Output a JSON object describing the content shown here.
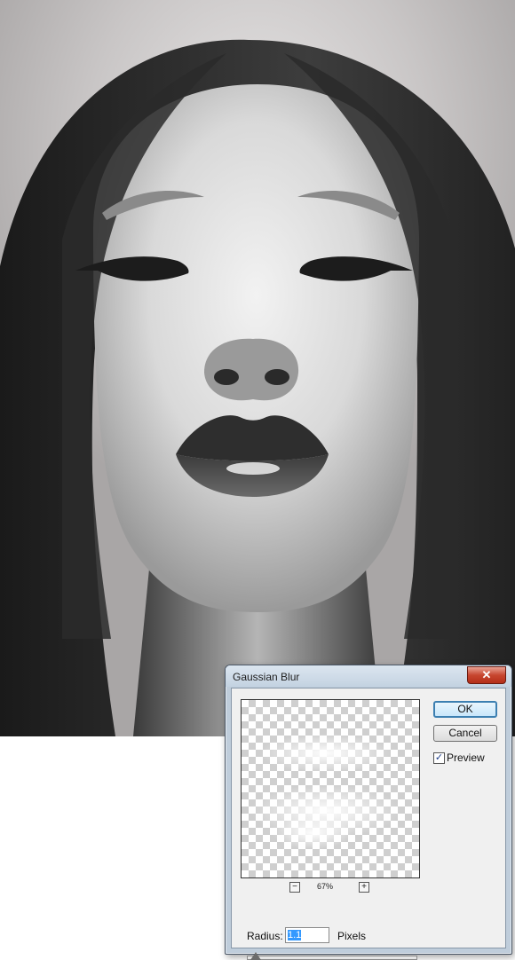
{
  "dialog": {
    "title": "Gaussian Blur",
    "close_symbol": "✕",
    "ok_label": "OK",
    "cancel_label": "Cancel",
    "preview_label": "Preview",
    "preview_checked": true,
    "zoom": {
      "minus": "−",
      "plus": "+",
      "level": "67%"
    },
    "radius": {
      "label": "Radius:",
      "value": "1.1",
      "unit": "Pixels"
    },
    "slider_level": 0.05
  },
  "icons": [
    "close-icon",
    "zoom-out-icon",
    "zoom-in-icon",
    "checkmark-icon"
  ],
  "colors": {
    "accent": "#3c7fb1",
    "close": "#c7462f",
    "selection": "#3399ff"
  }
}
